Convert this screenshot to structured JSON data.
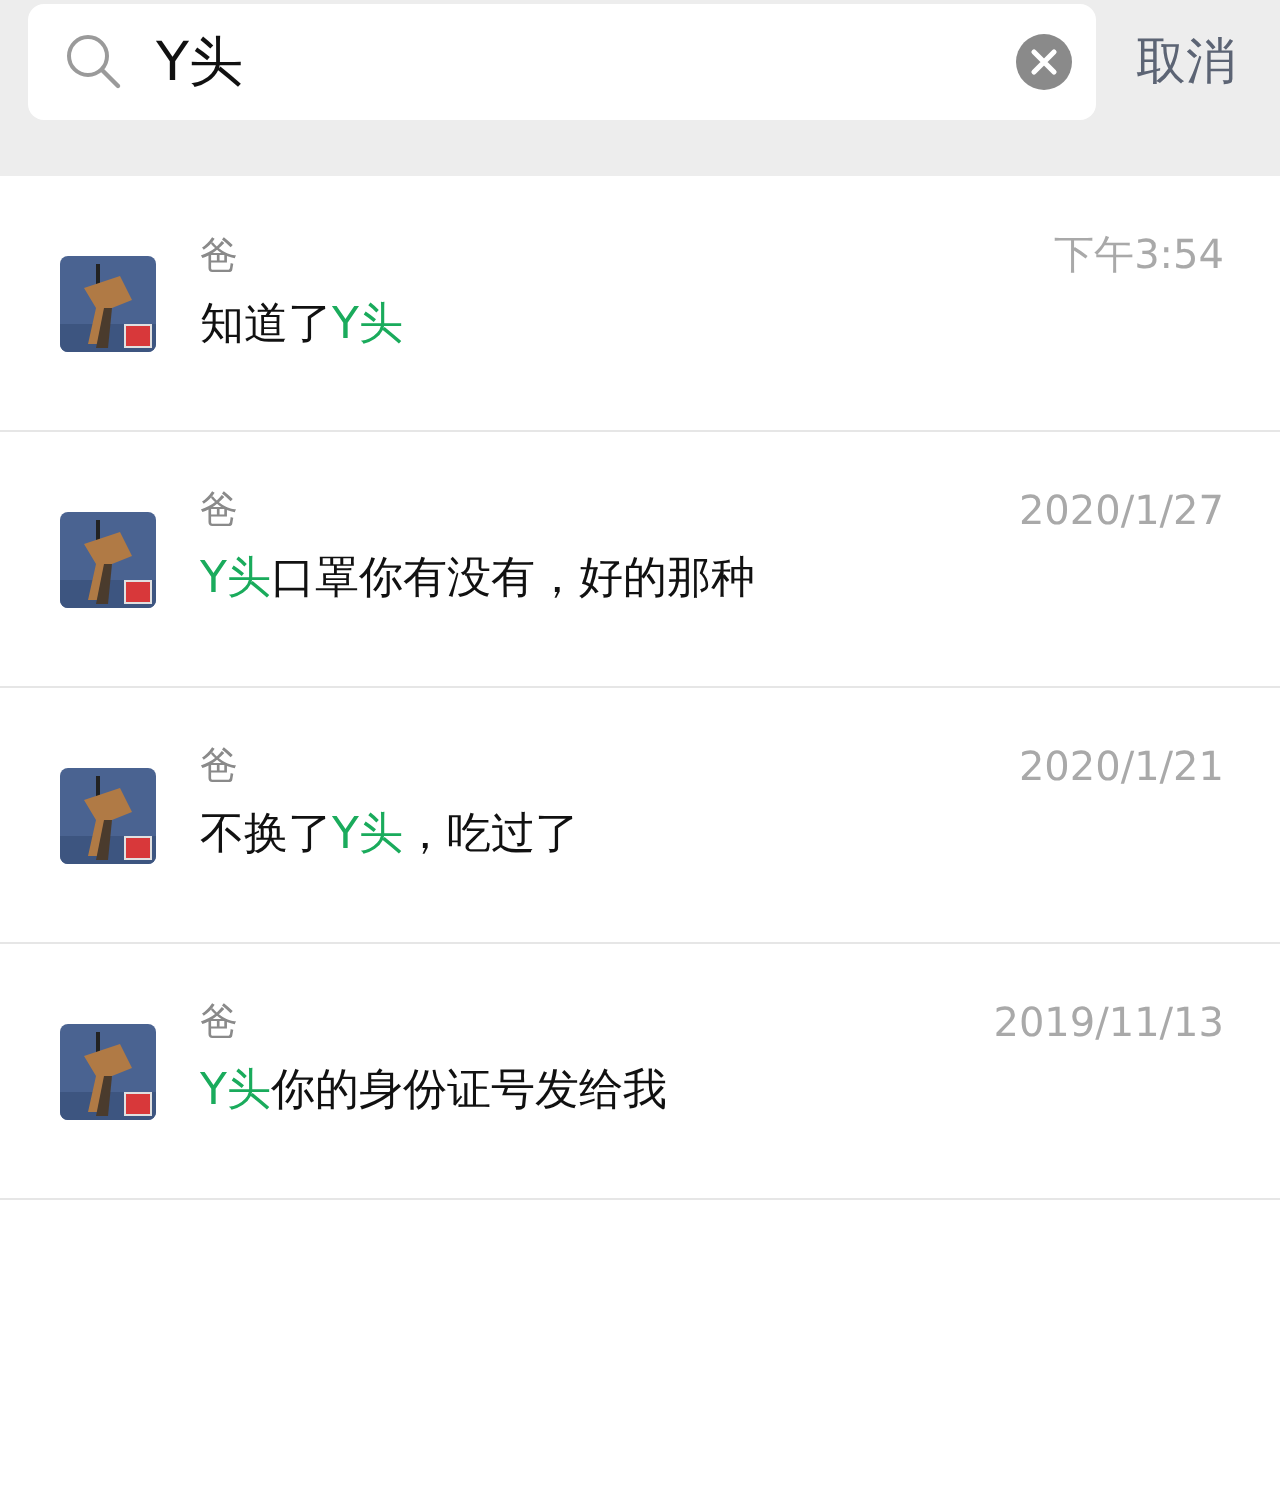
{
  "search": {
    "value": "Y头",
    "cancel": "取消"
  },
  "results": [
    {
      "name": "爸",
      "time": "下午3:54",
      "message": [
        {
          "text": "知道了"
        },
        {
          "text": "Y头",
          "highlight": true
        }
      ]
    },
    {
      "name": "爸",
      "time": "2020/1/27",
      "message": [
        {
          "text": "Y头",
          "highlight": true
        },
        {
          "text": "口罩你有没有，好的那种"
        }
      ]
    },
    {
      "name": "爸",
      "time": "2020/1/21",
      "message": [
        {
          "text": "不换了"
        },
        {
          "text": "Y头",
          "highlight": true
        },
        {
          "text": "，吃过了"
        }
      ]
    },
    {
      "name": "爸",
      "time": "2019/11/13",
      "message": [
        {
          "text": "Y头",
          "highlight": true
        },
        {
          "text": "你的身份证号发给我"
        }
      ]
    }
  ]
}
